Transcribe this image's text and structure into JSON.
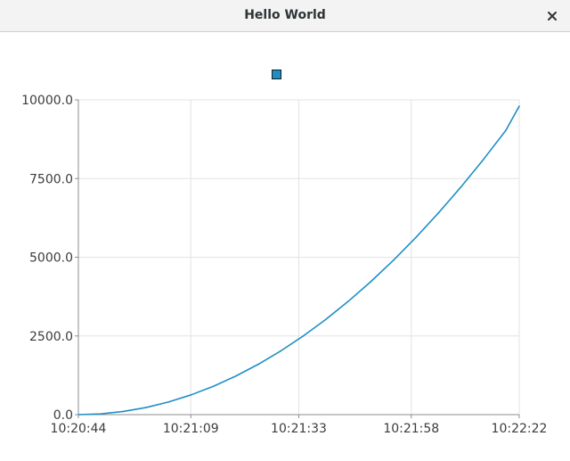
{
  "window": {
    "title": "Hello World",
    "close_icon": "close-icon"
  },
  "chart_data": {
    "type": "line",
    "title": "",
    "xlabel": "",
    "ylabel": "",
    "x_axis_kind": "time",
    "x_ticks": [
      "10:20:44",
      "10:21:09",
      "10:21:33",
      "10:21:58",
      "10:22:22"
    ],
    "y_ticks": [
      "0.0",
      "2500.0",
      "5000.0",
      "7500.0",
      "10000.0"
    ],
    "ylim": [
      0,
      10000
    ],
    "xlim": [
      "10:20:44",
      "10:22:22"
    ],
    "grid": true,
    "legend": {
      "position": "top-center",
      "entries": [
        {
          "name": "",
          "color": "#1e8fc6"
        }
      ]
    },
    "series": [
      {
        "name": "",
        "color": "#1e8fc6",
        "points": [
          {
            "x": "10:20:44",
            "y": 0
          },
          {
            "x": "10:20:49",
            "y": 25
          },
          {
            "x": "10:20:54",
            "y": 100
          },
          {
            "x": "10:20:59",
            "y": 225
          },
          {
            "x": "10:21:04",
            "y": 400
          },
          {
            "x": "10:21:09",
            "y": 625
          },
          {
            "x": "10:21:14",
            "y": 900
          },
          {
            "x": "10:21:19",
            "y": 1225
          },
          {
            "x": "10:21:24",
            "y": 1600
          },
          {
            "x": "10:21:29",
            "y": 2025
          },
          {
            "x": "10:21:34",
            "y": 2500
          },
          {
            "x": "10:21:39",
            "y": 3025
          },
          {
            "x": "10:21:44",
            "y": 3600
          },
          {
            "x": "10:21:49",
            "y": 4225
          },
          {
            "x": "10:21:54",
            "y": 4900
          },
          {
            "x": "10:21:59",
            "y": 5625
          },
          {
            "x": "10:22:04",
            "y": 6400
          },
          {
            "x": "10:22:09",
            "y": 7225
          },
          {
            "x": "10:22:14",
            "y": 8100
          },
          {
            "x": "10:22:19",
            "y": 9025
          },
          {
            "x": "10:22:22",
            "y": 9800
          }
        ]
      }
    ]
  }
}
